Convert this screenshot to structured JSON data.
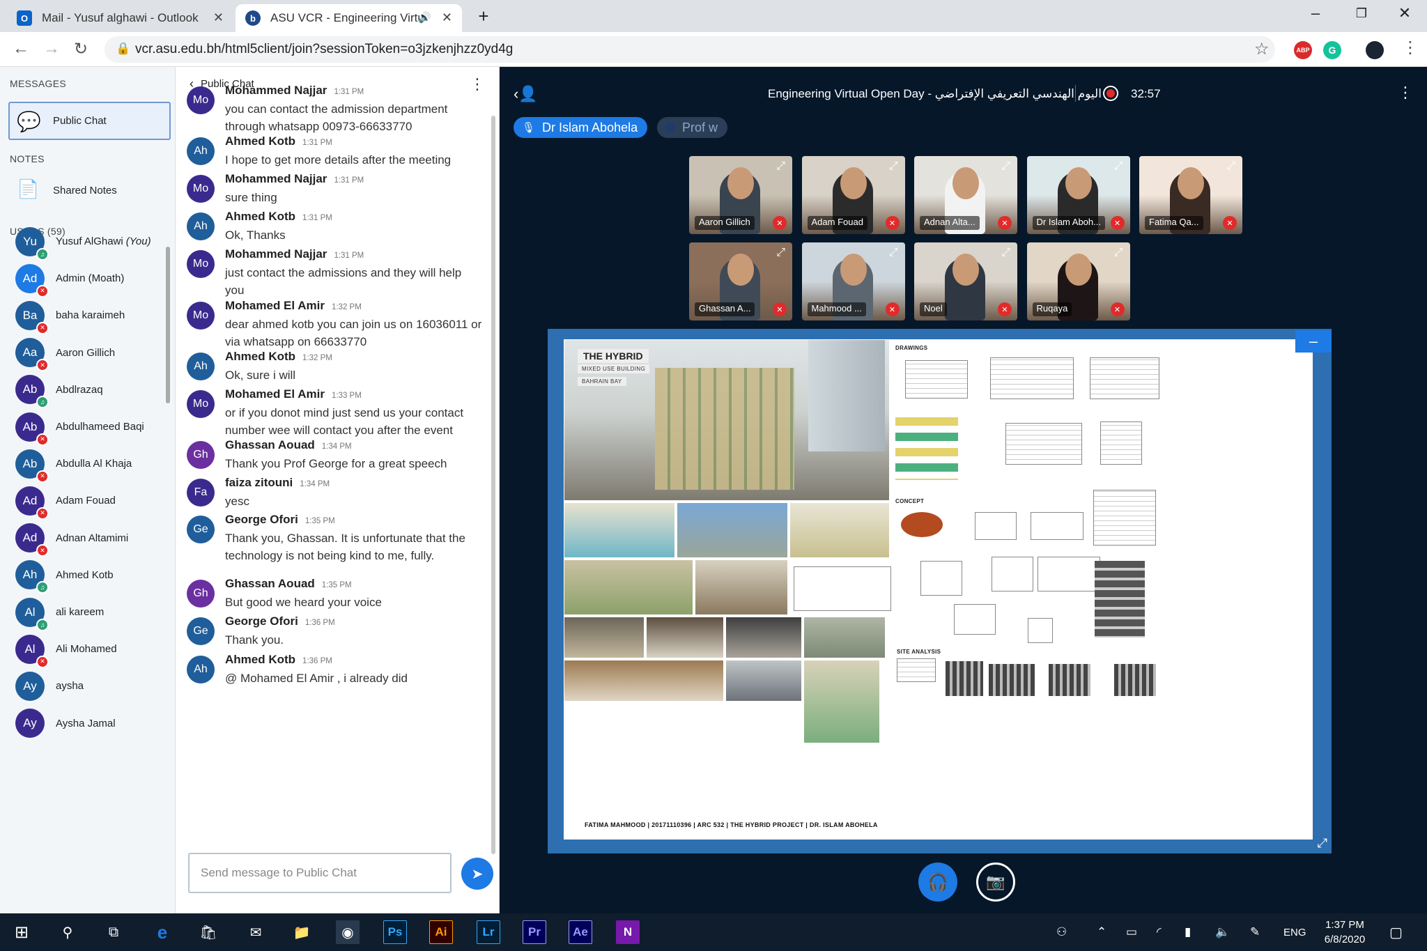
{
  "browser": {
    "tabs": [
      {
        "title": "Mail - Yusuf alghawi - Outlook",
        "active": false
      },
      {
        "title": "ASU VCR - Engineering Virtu",
        "active": true
      }
    ],
    "url": "vcr.asu.edu.bh/html5client/join?sessionToken=o3jzkenjhzz0yd4g",
    "ext_abp": "ABP",
    "ext_g": "G"
  },
  "sidebar": {
    "messages_header": "MESSAGES",
    "public_chat": "Public Chat",
    "notes_header": "NOTES",
    "shared_notes": "Shared Notes",
    "users_header": "USERS (59)",
    "users": [
      {
        "initials": "Yu",
        "name": "Yusuf AlGhawi",
        "suffix": "(You)",
        "color": "#1f5e9a",
        "badge": "#2e9e73"
      },
      {
        "initials": "Ad",
        "name": "Admin (Moath)",
        "suffix": "",
        "color": "#1e7ae4",
        "badge": "#e02b2b"
      },
      {
        "initials": "Ba",
        "name": "baha karaimeh",
        "suffix": "",
        "color": "#1f5e9a",
        "badge": "#e02b2b"
      },
      {
        "initials": "Aa",
        "name": "Aaron Gillich",
        "suffix": "",
        "color": "#1f5e9a",
        "badge": "#e02b2b"
      },
      {
        "initials": "Ab",
        "name": "Abdlrazaq",
        "suffix": "",
        "color": "#3b2a8e",
        "badge": "#2e9e73"
      },
      {
        "initials": "Ab",
        "name": "Abdulhameed Baqi",
        "suffix": "",
        "color": "#3b2a8e",
        "badge": "#e02b2b"
      },
      {
        "initials": "Ab",
        "name": "Abdulla Al Khaja",
        "suffix": "",
        "color": "#1f5e9a",
        "badge": "#e02b2b"
      },
      {
        "initials": "Ad",
        "name": "Adam Fouad",
        "suffix": "",
        "color": "#3b2a8e",
        "badge": "#e02b2b"
      },
      {
        "initials": "Ad",
        "name": "Adnan Altamimi",
        "suffix": "",
        "color": "#3b2a8e",
        "badge": "#e02b2b"
      },
      {
        "initials": "Ah",
        "name": "Ahmed Kotb",
        "suffix": "",
        "color": "#1f5e9a",
        "badge": "#2e9e73"
      },
      {
        "initials": "Al",
        "name": "ali kareem",
        "suffix": "",
        "color": "#1f5e9a",
        "badge": "#2e9e73"
      },
      {
        "initials": "Al",
        "name": "Ali Mohamed",
        "suffix": "",
        "color": "#3b2a8e",
        "badge": "#e02b2b"
      },
      {
        "initials": "Ay",
        "name": "aysha",
        "suffix": "",
        "color": "#1f5e9a",
        "badge": ""
      },
      {
        "initials": "Ay",
        "name": "Aysha Jamal",
        "suffix": "",
        "color": "#3b2a8e",
        "badge": ""
      }
    ]
  },
  "chat": {
    "title": "Public Chat",
    "input_placeholder": "Send message to Public Chat",
    "messages": [
      {
        "initials": "Mo",
        "color": "#3b2a8e",
        "author": "Mohammed Najjar",
        "time": "1:31 PM",
        "text": "you can contact the admission department through whatsapp 00973-66633770"
      },
      {
        "initials": "Ah",
        "color": "#1f5e9a",
        "author": "Ahmed Kotb",
        "time": "1:31 PM",
        "text": "I hope to get more details after the meeting"
      },
      {
        "initials": "Mo",
        "color": "#3b2a8e",
        "author": "Mohammed Najjar",
        "time": "1:31 PM",
        "text": "sure thing"
      },
      {
        "initials": "Ah",
        "color": "#1f5e9a",
        "author": "Ahmed Kotb",
        "time": "1:31 PM",
        "text": "Ok, Thanks"
      },
      {
        "initials": "Mo",
        "color": "#3b2a8e",
        "author": "Mohammed Najjar",
        "time": "1:31 PM",
        "text": "just contact the admissions and they will help you"
      },
      {
        "initials": "Mo",
        "color": "#3b2a8e",
        "author": "Mohamed El Amir",
        "time": "1:32 PM",
        "text": "dear ahmed kotb you can join us on 16036011 or via whatsapp on 66633770"
      },
      {
        "initials": "Ah",
        "color": "#1f5e9a",
        "author": "Ahmed Kotb",
        "time": "1:32 PM",
        "text": "Ok, sure i will"
      },
      {
        "initials": "Mo",
        "color": "#3b2a8e",
        "author": "Mohamed El Amir",
        "time": "1:33 PM",
        "text": "or if you donot mind just send us your contact number wee will contact you after the event"
      },
      {
        "initials": "Gh",
        "color": "#6b2fa0",
        "author": "Ghassan Aouad",
        "time": "1:34 PM",
        "text": "Thank you Prof George for a great speech"
      },
      {
        "initials": "Fa",
        "color": "#3b2a8e",
        "author": "faiza zitouni",
        "time": "1:34 PM",
        "text": "yesc"
      },
      {
        "initials": "Ge",
        "color": "#1f5e9a",
        "author": "George Ofori",
        "time": "1:35 PM",
        "text": "Thank you, Ghassan. It is unfortunate that the technology is not being kind to me, fully."
      },
      {
        "initials": "Gh",
        "color": "#6b2fa0",
        "author": "Ghassan Aouad",
        "time": "1:35 PM",
        "text": "But good we heard your voice"
      },
      {
        "initials": "Ge",
        "color": "#1f5e9a",
        "author": "George Ofori",
        "time": "1:36 PM",
        "text": "Thank you."
      },
      {
        "initials": "Ah",
        "color": "#1f5e9a",
        "author": "Ahmed Kotb",
        "time": "1:36 PM",
        "text": "@ Mohamed El Amir , i already did"
      }
    ]
  },
  "meeting": {
    "title": "Engineering Virtual Open Day - اليوم الهندسي التعريفي الإفتراضي",
    "rec_time": "32:57",
    "talkers": [
      {
        "name": "Dr Islam Abohela",
        "active": true
      },
      {
        "name": "Prof w",
        "active": false
      }
    ],
    "videos": [
      {
        "name": "Aaron Gillich"
      },
      {
        "name": "Adam Fouad"
      },
      {
        "name": "Adnan Alta..."
      },
      {
        "name": "Dr Islam Aboh..."
      },
      {
        "name": "Fatima Qa..."
      },
      {
        "name": "Ghassan A..."
      },
      {
        "name": "Mahmood ..."
      },
      {
        "name": "Noel"
      },
      {
        "name": "Ruqaya"
      }
    ]
  },
  "slide": {
    "title": "THE HYBRID",
    "sub1": "MIXED USE BUILDING",
    "sub2": "BAHRAIN BAY",
    "drawings": "DRAWINGS",
    "concept": "CONCEPT",
    "site_analysis": "SITE ANALYSIS",
    "footer": "FATIMA MAHMOOD | 20171110396 | ARC 532 | THE HYBRID PROJECT | DR. ISLAM ABOHELA"
  },
  "taskbar": {
    "lang": "ENG",
    "time": "1:37 PM",
    "date": "6/8/2020"
  }
}
